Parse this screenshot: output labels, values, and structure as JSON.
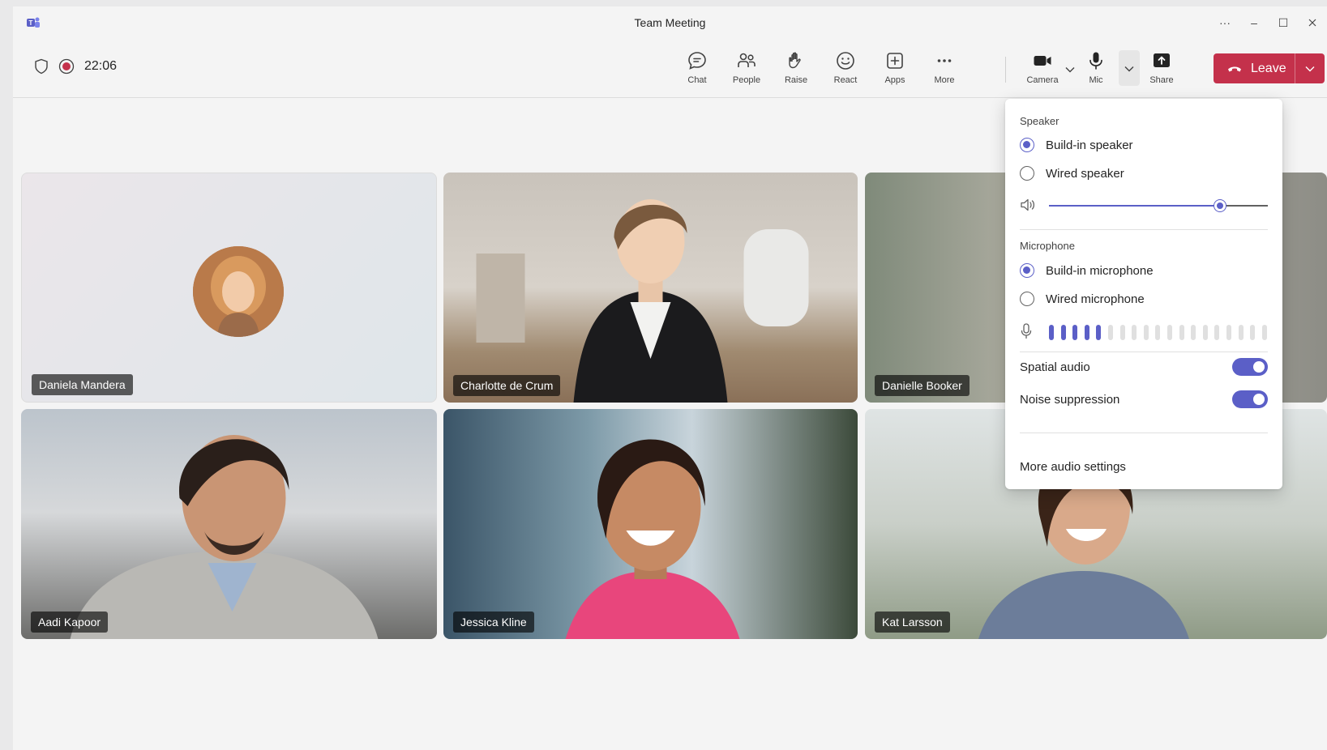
{
  "window": {
    "title": "Team Meeting",
    "controls": [
      "···",
      "–",
      "☐"
    ]
  },
  "meeting": {
    "timer": "22:06",
    "status_icons": [
      "shield-icon",
      "recording-icon"
    ]
  },
  "toolbar": {
    "chat": "Chat",
    "people": "People",
    "raise": "Raise",
    "react": "React",
    "apps": "Apps",
    "more": "More",
    "camera": "Camera",
    "mic": "Mic",
    "share": "Share",
    "leave": "Leave"
  },
  "participants": [
    {
      "name": "Daniela Mandera"
    },
    {
      "name": "Charlotte de Crum"
    },
    {
      "name": "Danielle Booker"
    },
    {
      "name": "Aadi Kapoor"
    },
    {
      "name": "Jessica Kline"
    },
    {
      "name": "Kat Larsson"
    }
  ],
  "audio_panel": {
    "speaker_title": "Speaker",
    "speaker_options": [
      {
        "label": "Build-in speaker",
        "selected": true
      },
      {
        "label": "Wired speaker",
        "selected": false
      }
    ],
    "speaker_volume": 0.78,
    "microphone_title": "Microphone",
    "microphone_options": [
      {
        "label": "Build-in microphone",
        "selected": true
      },
      {
        "label": "Wired microphone",
        "selected": false
      }
    ],
    "mic_level_active_bars": 5,
    "mic_level_total_bars": 19,
    "spatial_audio": {
      "label": "Spatial audio",
      "on": true
    },
    "noise_suppression": {
      "label": "Noise suppression",
      "on": true
    },
    "more_settings": "More audio settings"
  },
  "colors": {
    "accent": "#5b5fc7",
    "leave": "#c4314b",
    "recording": "#c4314b"
  }
}
